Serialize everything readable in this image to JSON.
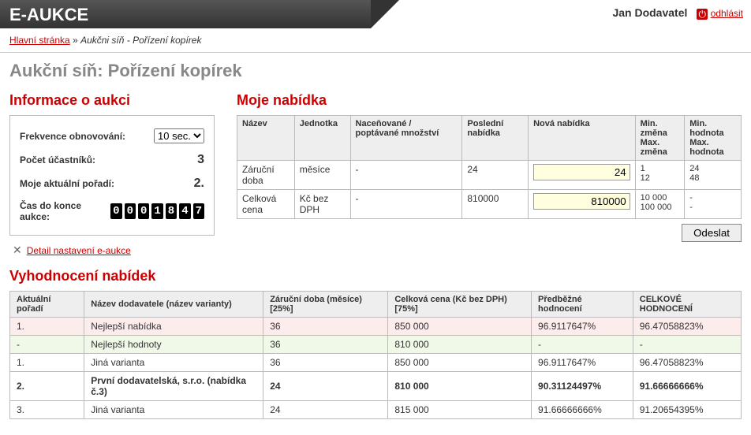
{
  "app": {
    "title": "E-AUKCE"
  },
  "user": {
    "name": "Jan Dodavatel",
    "logout": "odhlásit"
  },
  "breadcrumb": {
    "home": "Hlavní stránka",
    "sep": "»",
    "current": "Aukčni síň - Pořízení kopírek"
  },
  "page": {
    "title": "Aukční síň: Pořízení kopírek"
  },
  "info": {
    "heading": "Informace o aukci",
    "refresh_label": "Frekvence obnovování:",
    "refresh_value": "10 sec.",
    "participants_label": "Počet účastníků:",
    "participants_value": "3",
    "rank_label": "Moje aktuální pořadí:",
    "rank_value": "2.",
    "time_label": "Čas do konce aukce:",
    "time_digits": [
      "0",
      "0",
      "0",
      "1",
      "8",
      "4",
      "7"
    ],
    "settings_link": "Detail nastavení e-aukce"
  },
  "offer": {
    "heading": "Moje nabídka",
    "th": {
      "name": "Název",
      "unit": "Jednotka",
      "qty": "Naceňované / poptávané množství",
      "last": "Poslední nabídka",
      "new": "Nová nabídka",
      "delta": "Min. změna\nMax. změna",
      "bound": "Min. hodnota\nMax. hodnota"
    },
    "rows": [
      {
        "name": "Záruční doba",
        "unit": "měsíce",
        "qty": "-",
        "last": "24",
        "new": "24",
        "delta1": "1",
        "delta2": "12",
        "bound1": "24",
        "bound2": "48"
      },
      {
        "name": "Celková cena",
        "unit": "Kč bez DPH",
        "qty": "-",
        "last": "810000",
        "new": "810000",
        "delta1": "10 000",
        "delta2": "100 000",
        "bound1": "-",
        "bound2": "-"
      }
    ],
    "submit": "Odeslat"
  },
  "eval": {
    "heading": "Vyhodnocení nabídek",
    "th": {
      "rank": "Aktuální pořadí",
      "supplier": "Název dodavatele (název varianty)",
      "warranty": "Záruční doba (měsíce) [25%]",
      "price": "Celková cena (Kč bez DPH) [75%]",
      "prelim": "Předběžné hodnocení",
      "total": "CELKOVÉ HODNOCENÍ"
    },
    "rows": [
      {
        "cls": "best",
        "rank": "1.",
        "supplier": "Nejlepší nabídka",
        "warranty": "36",
        "price": "850 000",
        "prelim": "96.9117647%",
        "total": "96.47058823%"
      },
      {
        "cls": "bestv",
        "rank": "-",
        "supplier": "Nejlepší hodnoty",
        "warranty": "36",
        "price": "810 000",
        "prelim": "-",
        "total": "-"
      },
      {
        "cls": "",
        "rank": "1.",
        "supplier": "Jiná varianta",
        "warranty": "36",
        "price": "850 000",
        "prelim": "96.9117647%",
        "total": "96.47058823%"
      },
      {
        "cls": "bold",
        "rank": "2.",
        "supplier": "První dodavatelská, s.r.o. (nabídka č.3)",
        "warranty": "24",
        "price": "810 000",
        "prelim": "90.31124497%",
        "total": "91.66666666%"
      },
      {
        "cls": "",
        "rank": "3.",
        "supplier": "Jiná varianta",
        "warranty": "24",
        "price": "815 000",
        "prelim": "91.66666666%",
        "total": "91.20654395%"
      }
    ]
  }
}
